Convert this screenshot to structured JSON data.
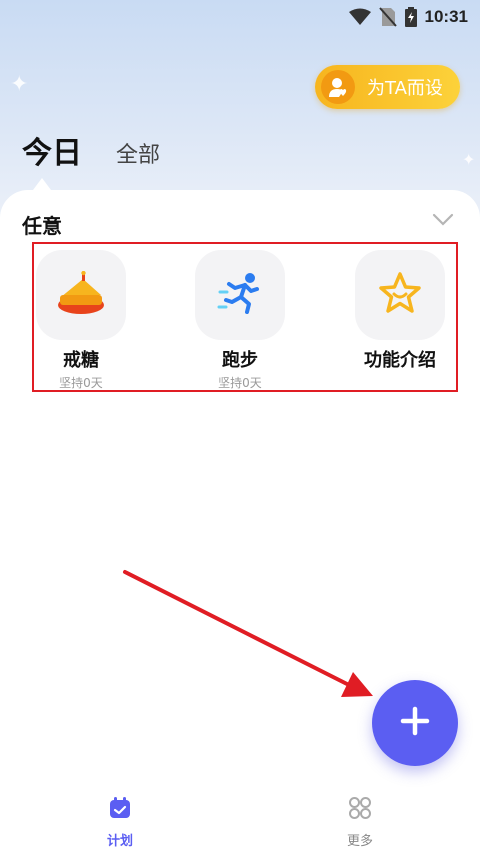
{
  "status_bar": {
    "time": "10:31",
    "icons": [
      "wifi-icon",
      "no-sim-icon",
      "battery-charging-icon"
    ]
  },
  "header": {
    "ta_button_label": "为TA而设"
  },
  "tabs": [
    {
      "label": "今日",
      "active": true
    },
    {
      "label": "全部",
      "active": false
    }
  ],
  "section": {
    "title": "任意"
  },
  "plans": [
    {
      "name": "戒糖",
      "subtitle": "坚持0天",
      "icon": "cake-icon"
    },
    {
      "name": "跑步",
      "subtitle": "坚持0天",
      "icon": "running-icon"
    },
    {
      "name": "功能介绍",
      "subtitle": "",
      "icon": "smiley-star-icon"
    }
  ],
  "fab": {
    "icon": "plus-icon"
  },
  "bottom_nav": [
    {
      "label": "计划",
      "icon": "calendar-icon",
      "active": true
    },
    {
      "label": "更多",
      "icon": "grid-icon",
      "active": false
    }
  ],
  "colors": {
    "accent": "#5b5ef2",
    "highlight_border": "#e01d24",
    "ta_button": "#f7b51e"
  }
}
